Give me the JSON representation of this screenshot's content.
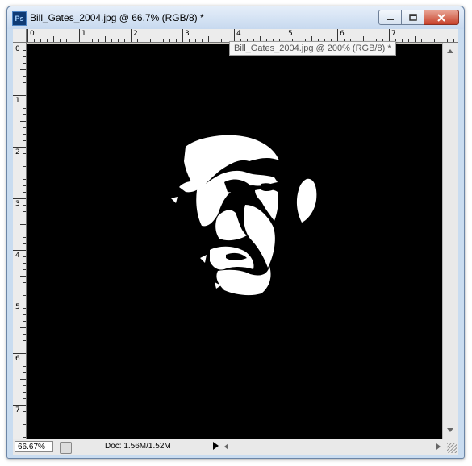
{
  "window": {
    "app_icon": "photoshop-icon",
    "app_icon_text": "Ps",
    "title": "Bill_Gates_2004.jpg @ 66.7% (RGB/8) *",
    "buttons": [
      "minimize-icon",
      "maximize-icon",
      "close-icon"
    ]
  },
  "tooltip": {
    "text": "Bill_Gates_2004.jpg @ 200% (RGB/8) *"
  },
  "rulers": {
    "horizontal_labels": [
      "0",
      "1",
      "2",
      "3",
      "4",
      "5",
      "6",
      "7"
    ],
    "vertical_labels": [
      "0",
      "1",
      "2",
      "3",
      "4",
      "5",
      "6",
      "7"
    ]
  },
  "status_bar": {
    "zoom": "66.67%",
    "doc_info": "Doc: 1.56M/1.52M"
  },
  "colors": {
    "canvas_background": "#000000",
    "image_foreground": "#ffffff",
    "title_bar": "#c7d9ef",
    "close_button": "#c7412a"
  }
}
